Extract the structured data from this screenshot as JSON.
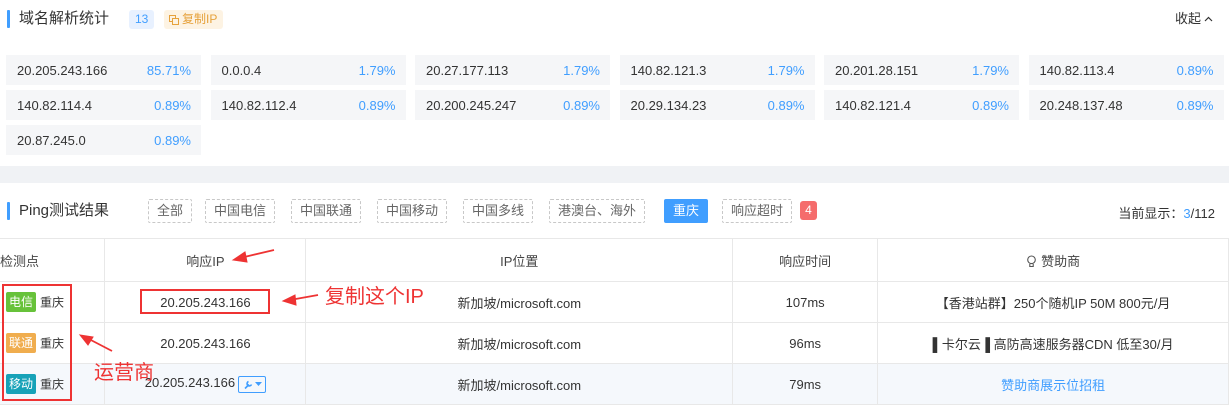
{
  "stats_panel": {
    "title": "域名解析统计",
    "count": "13",
    "copy_label": "复制IP",
    "collapse_label": "收起",
    "items": [
      {
        "ip": "20.205.243.166",
        "pct": "85.71%"
      },
      {
        "ip": "0.0.0.4",
        "pct": "1.79%"
      },
      {
        "ip": "20.27.177.113",
        "pct": "1.79%"
      },
      {
        "ip": "140.82.121.3",
        "pct": "1.79%"
      },
      {
        "ip": "20.201.28.151",
        "pct": "1.79%"
      },
      {
        "ip": "140.82.113.4",
        "pct": "0.89%"
      },
      {
        "ip": "140.82.114.4",
        "pct": "0.89%"
      },
      {
        "ip": "140.82.112.4",
        "pct": "0.89%"
      },
      {
        "ip": "20.200.245.247",
        "pct": "0.89%"
      },
      {
        "ip": "20.29.134.23",
        "pct": "0.89%"
      },
      {
        "ip": "140.82.121.4",
        "pct": "0.89%"
      },
      {
        "ip": "20.248.137.48",
        "pct": "0.89%"
      },
      {
        "ip": "20.87.245.0",
        "pct": "0.89%"
      }
    ]
  },
  "ping_panel": {
    "title": "Ping测试结果",
    "filters": [
      "全部",
      "中国电信",
      "中国联通",
      "中国移动",
      "中国多线",
      "港澳台、海外",
      "重庆",
      "响应超时"
    ],
    "active_filter": "重庆",
    "timeout_count": "4",
    "display_label": "当前显示：",
    "display_current": "3",
    "display_total": "/112",
    "columns": {
      "point": "检测点",
      "ip": "响应IP",
      "location": "IP位置",
      "time": "响应时间",
      "sponsor": "赞助商"
    },
    "rows": [
      {
        "isp": "电信",
        "isp_color": "#67c23a",
        "city": "重庆",
        "ip": "20.205.243.166",
        "location": "新加坡/microsoft.com",
        "time": "107ms",
        "sponsor": "【香港站群】250个随机IP 50M 800元/月"
      },
      {
        "isp": "联通",
        "isp_color": "#f0ad4e",
        "city": "重庆",
        "ip": "20.205.243.166",
        "location": "新加坡/microsoft.com",
        "time": "96ms",
        "sponsor": "▌卡尔云▐ 高防高速服务器CDN 低至30/月"
      },
      {
        "isp": "移动",
        "isp_color": "#17a2b8",
        "city": "重庆",
        "ip": "20.205.243.166",
        "location": "新加坡/microsoft.com",
        "time": "79ms",
        "sponsor": "赞助商展示位招租"
      }
    ]
  },
  "annotations": {
    "copy_ip": "复制这个IP",
    "carrier": "运营商"
  },
  "colors": {
    "accent": "#409eff",
    "annotation": "#e33333",
    "timeout": "#f56c6c"
  }
}
